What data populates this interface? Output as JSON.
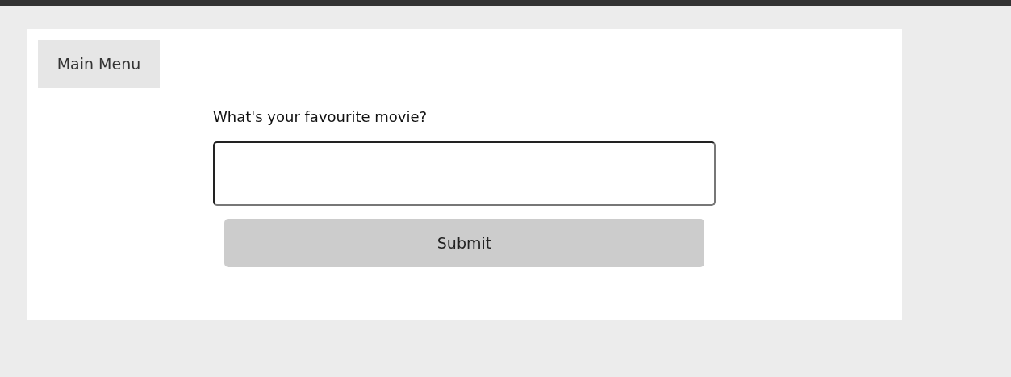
{
  "menu_button": {
    "label": "Main Menu"
  },
  "question": {
    "label": "What's your favourite movie?"
  },
  "submit_button": {
    "label": "Submit"
  }
}
